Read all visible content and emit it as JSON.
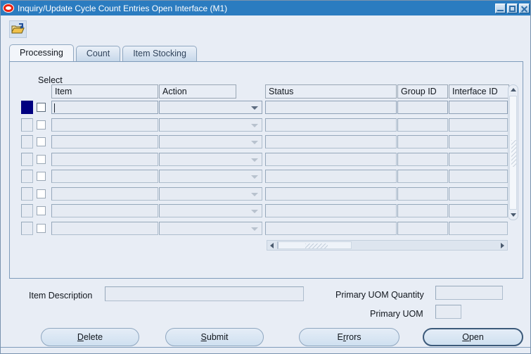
{
  "window": {
    "title": "Inquiry/Update Cycle Count Entries Open Interface (M1)",
    "logo": "oracle-logo",
    "controls": {
      "minimize": "minimize-button",
      "maximize": "maximize-button",
      "close": "close-button"
    },
    "accent_color": "#2b7cc0",
    "body_color": "#e8edf5"
  },
  "toolbar": {
    "open_folder_tooltip": "Open"
  },
  "tabs": [
    {
      "label": "Processing",
      "active": true
    },
    {
      "label": "Count",
      "active": false
    },
    {
      "label": "Item Stocking",
      "active": false
    }
  ],
  "grid": {
    "select_label": "Select",
    "columns_left": [
      {
        "label": "Item"
      },
      {
        "label": "Action"
      }
    ],
    "columns_right": [
      {
        "label": "Status"
      },
      {
        "label": "Group ID"
      },
      {
        "label": "Interface ID"
      }
    ],
    "row_count": 8,
    "current_row": 1,
    "rows": [
      {
        "item": "",
        "action": "",
        "status": "",
        "group_id": "",
        "interface_id": "",
        "checked": false
      },
      {
        "item": "",
        "action": "",
        "status": "",
        "group_id": "",
        "interface_id": "",
        "checked": false
      },
      {
        "item": "",
        "action": "",
        "status": "",
        "group_id": "",
        "interface_id": "",
        "checked": false
      },
      {
        "item": "",
        "action": "",
        "status": "",
        "group_id": "",
        "interface_id": "",
        "checked": false
      },
      {
        "item": "",
        "action": "",
        "status": "",
        "group_id": "",
        "interface_id": "",
        "checked": false
      },
      {
        "item": "",
        "action": "",
        "status": "",
        "group_id": "",
        "interface_id": "",
        "checked": false
      },
      {
        "item": "",
        "action": "",
        "status": "",
        "group_id": "",
        "interface_id": "",
        "checked": false
      },
      {
        "item": "",
        "action": "",
        "status": "",
        "group_id": "",
        "interface_id": "",
        "checked": false
      }
    ],
    "vertical_scrollbar": {
      "up_icon": "scroll-up-icon",
      "down_icon": "scroll-down-icon"
    },
    "horizontal_scrollbar": {
      "left_icon": "scroll-left-icon",
      "right_icon": "scroll-right-icon"
    }
  },
  "details": {
    "item_description_label": "Item Description",
    "item_description_value": "",
    "primary_uom_quantity_label": "Primary UOM Quantity",
    "primary_uom_quantity_value": "",
    "primary_uom_label": "Primary UOM",
    "primary_uom_value": ""
  },
  "buttons": [
    {
      "name": "delete",
      "pre": "",
      "mnemonic": "D",
      "post": "elete",
      "focused": false
    },
    {
      "name": "submit",
      "pre": "",
      "mnemonic": "S",
      "post": "ubmit",
      "focused": false
    },
    {
      "name": "errors",
      "pre": "E",
      "mnemonic": "r",
      "post": "rors",
      "focused": false
    },
    {
      "name": "open",
      "pre": "",
      "mnemonic": "O",
      "post": "pen",
      "focused": true
    }
  ]
}
